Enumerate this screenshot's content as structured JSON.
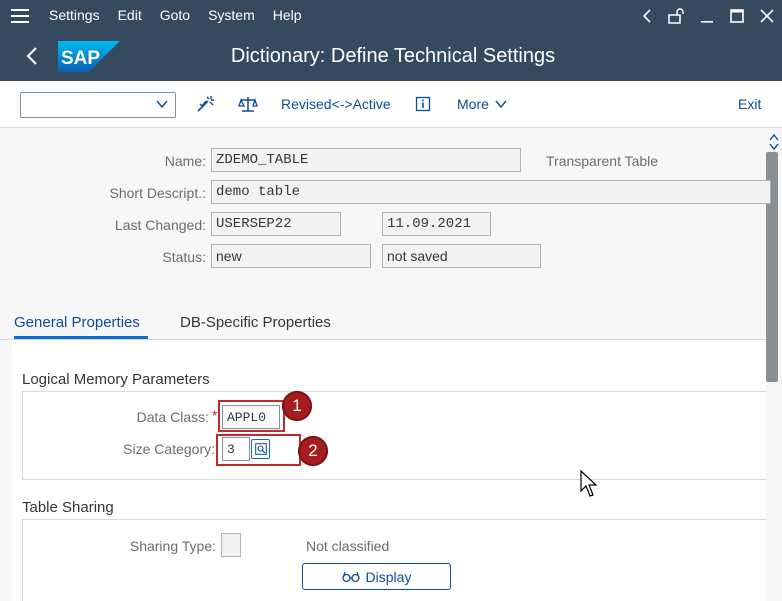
{
  "menu": {
    "items": [
      "Settings",
      "Edit",
      "Goto",
      "System",
      "Help"
    ]
  },
  "header": {
    "title": "Dictionary: Define Technical Settings",
    "logo_text": "SAP"
  },
  "toolbar": {
    "command_field_value": "",
    "revised_active_label": "Revised<->Active",
    "more_label": "More",
    "exit_label": "Exit"
  },
  "form": {
    "name_label": "Name:",
    "name_value": "ZDEMO_TABLE",
    "table_type": "Transparent Table",
    "short_desc_label": "Short Descript.:",
    "short_desc_value": "demo table",
    "last_changed_label": "Last Changed:",
    "last_changed_user": "USERSEP22",
    "last_changed_date": "11.09.2021",
    "status_label": "Status:",
    "status_value": "new",
    "status_save": "not saved"
  },
  "tabs": {
    "general": "General Properties",
    "db_specific": "DB-Specific Properties"
  },
  "logical_memory": {
    "title": "Logical Memory Parameters",
    "data_class_label": "Data Class:",
    "data_class_value": "APPL0",
    "size_category_label": "Size Category:",
    "size_category_value": "3"
  },
  "table_sharing": {
    "title": "Table Sharing",
    "sharing_type_label": "Sharing Type:",
    "sharing_type_value": "",
    "classification": "Not classified",
    "display_button": "Display"
  },
  "annotations": {
    "badge_1": "1",
    "badge_2": "2"
  },
  "colors": {
    "shell": "#354a5f",
    "accent": "#0a6ed1",
    "highlight": "#c0282b"
  }
}
